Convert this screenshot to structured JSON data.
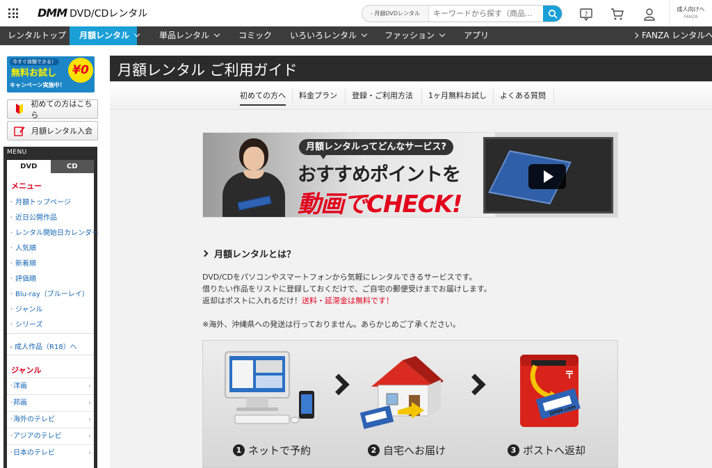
{
  "header": {
    "logo_mark": "DMM",
    "logo_text": "DVD/CDレンタル",
    "search_select": "- 月額DVDレンタル",
    "search_placeholder": "キーワードから探す（商品...",
    "adult_line1": "成人向けへ",
    "adult_line2": "FANZA"
  },
  "nav": {
    "items": [
      {
        "label": "レンタルトップ"
      },
      {
        "label": "月額レンタル"
      },
      {
        "label": "単品レンタル"
      },
      {
        "label": "コミック"
      },
      {
        "label": "いろいろレンタル"
      },
      {
        "label": "ファッション"
      },
      {
        "label": "アプリ"
      }
    ],
    "fanza": "FANZA レンタルへ"
  },
  "sidebar": {
    "promo_line1": "今すぐ体験できる！",
    "promo_line2": "無料お試し",
    "promo_line3": "キャンペーン実施中！",
    "promo_badge": "¥0",
    "btn_first": "初めての方はこちら",
    "btn_join": "月額レンタル入会",
    "menu_label": "MENU",
    "tab_dvd": "DVD",
    "tab_cd": "CD",
    "menu_head": "メニュー",
    "menu_items": [
      "月額トップページ",
      "近日公開作品",
      "レンタル開始日カレンダー",
      "人気順",
      "新着順",
      "評価順",
      "Blu-ray（ブルーレイ）",
      "ジャンル",
      "シリーズ"
    ],
    "adult_link": "成人作品（R18）へ",
    "genre_head": "ジャンル",
    "genre_items": [
      "洋画",
      "邦画",
      "海外のテレビ",
      "アジアのテレビ",
      "日本のテレビ"
    ]
  },
  "main": {
    "title": "月額レンタル ご利用ガイド",
    "subnav": [
      "初めての方へ",
      "料金プラン",
      "登録・ご利用方法",
      "1ヶ月無料お試し",
      "よくある質問"
    ],
    "banner_bubble": "月額レンタルってどんなサービス?",
    "banner_line1": "おすすめポイントを",
    "banner_line2": "動画でCHECK!",
    "about_heading": "月額レンタルとは？",
    "para1": "DVD/CDをパソコンやスマートフォンから気軽にレンタルできるサービスです。",
    "para2": "借りたい作品をリストに登録しておくだけで、ご自宅の郵便受けまでお届けします。",
    "para3_a": "返却はポストに入れるだけ！",
    "para3_b": "送料・延滞金は無料です！",
    "note": "※海外、沖縄県への発送は行っておりません。あらかじめご了承ください。",
    "steps": [
      {
        "num": "1",
        "label": "ネットで予約"
      },
      {
        "num": "2",
        "label": "自宅へお届け"
      },
      {
        "num": "3",
        "label": "ポストへ返却"
      }
    ],
    "dmm_card": "DMM.com"
  },
  "colors": {
    "accent": "#1a9fd6",
    "nav_bg": "#3c3c3c",
    "red": "#e3001b"
  }
}
